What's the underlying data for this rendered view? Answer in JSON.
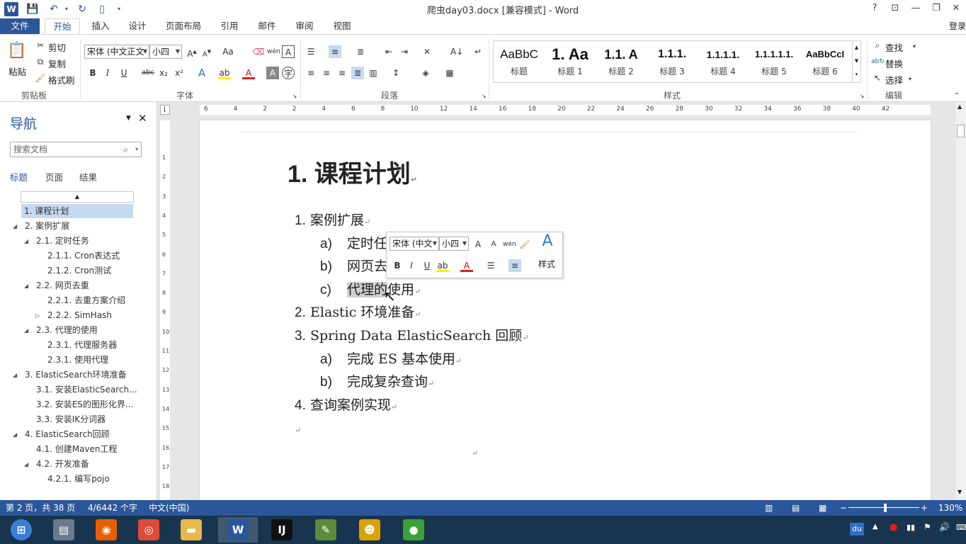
{
  "window": {
    "title": "爬虫day03.docx [兼容模式] - Word",
    "controls": {
      "help": "?",
      "restore_ribbon": "⊡",
      "minimize": "—",
      "maximize": "❐",
      "close": "✕"
    }
  },
  "ribbon_tabs": [
    "文件",
    "开始",
    "插入",
    "设计",
    "页面布局",
    "引用",
    "邮件",
    "审阅",
    "视图"
  ],
  "login_label": "登录",
  "ribbon": {
    "clipboard": {
      "paste": "粘贴",
      "cut": "剪切",
      "copy": "复制",
      "format_painter": "格式刷",
      "label": "剪贴板"
    },
    "font": {
      "name": "宋体 (中文正文",
      "size": "小四",
      "label": "字体"
    },
    "paragraph": {
      "label": "段落"
    },
    "styles": {
      "label": "样式",
      "items": [
        {
          "sample": "AaBbC",
          "name": "标题"
        },
        {
          "sample": "1. ",
          "name": "标题 1"
        },
        {
          "sample": "1.1. A",
          "name": "标题 2"
        },
        {
          "sample": "1.1.1.",
          "name": "标题 3"
        },
        {
          "sample": "1.1.1.1.",
          "name": "标题 4"
        },
        {
          "sample": "1.1.1.1.1.",
          "name": "标题 5"
        },
        {
          "sample": "AaBbCcI",
          "name": "标题 6"
        }
      ]
    },
    "editing": {
      "find": "查找",
      "replace": "替换",
      "select": "选择",
      "label": "编辑"
    }
  },
  "nav": {
    "title": "导航",
    "search_placeholder": "搜索文档",
    "tabs": [
      "标题",
      "页面",
      "结果"
    ],
    "items": [
      {
        "text": "1. 课程计划",
        "level": 1,
        "toggle": "",
        "selected": true
      },
      {
        "text": "2. 案例扩展",
        "level": 1,
        "toggle": "◢"
      },
      {
        "text": "2.1. 定时任务",
        "level": 2,
        "toggle": "◢"
      },
      {
        "text": "2.1.1. Cron表达式",
        "level": 3,
        "toggle": ""
      },
      {
        "text": "2.1.2. Cron测试",
        "level": 3,
        "toggle": ""
      },
      {
        "text": "2.2. 网页去重",
        "level": 2,
        "toggle": "◢"
      },
      {
        "text": "2.2.1. 去重方案介绍",
        "level": 3,
        "toggle": ""
      },
      {
        "text": "2.2.2. SimHash",
        "level": 3,
        "toggle": "▷"
      },
      {
        "text": "2.3. 代理的使用",
        "level": 2,
        "toggle": "◢"
      },
      {
        "text": "2.3.1. 代理服务器",
        "level": 3,
        "toggle": ""
      },
      {
        "text": "2.3.1. 使用代理",
        "level": 3,
        "toggle": ""
      },
      {
        "text": "3. ElasticSearch环境准备",
        "level": 1,
        "toggle": "◢"
      },
      {
        "text": "3.1. 安装ElasticSearch...",
        "level": 2,
        "toggle": ""
      },
      {
        "text": "3.2. 安装ES的图形化界...",
        "level": 2,
        "toggle": ""
      },
      {
        "text": "3.3. 安装IK分词器",
        "level": 2,
        "toggle": ""
      },
      {
        "text": "4. ElasticSearch回顾",
        "level": 1,
        "toggle": "◢"
      },
      {
        "text": "4.1. 创建Maven工程",
        "level": 2,
        "toggle": ""
      },
      {
        "text": "4.2. 开发准备",
        "level": 2,
        "toggle": "◢"
      },
      {
        "text": "4.2.1. 编写pojo",
        "level": 3,
        "toggle": ""
      }
    ]
  },
  "ruler": {
    "h_ticks": [
      "6",
      "4",
      "2",
      "2",
      "4",
      "6",
      "8",
      "10",
      "12",
      "14",
      "16",
      "18",
      "20",
      "22",
      "24",
      "26",
      "28",
      "30",
      "32",
      "34",
      "36",
      "38",
      "40",
      "42"
    ],
    "v_ticks": [
      "1",
      "2",
      "3",
      "4",
      "5",
      "6",
      "7",
      "8",
      "9",
      "10",
      "11",
      "12",
      "13",
      "14",
      "15",
      "16",
      "17",
      "18"
    ]
  },
  "document": {
    "heading": "1. 课程计划",
    "lines": [
      {
        "num": "1.",
        "text": "案例扩展"
      },
      {
        "num": "a)",
        "text": "定时任"
      },
      {
        "num": "b)",
        "text": "网页去"
      },
      {
        "num": "c)",
        "text": "代理的使用",
        "selected_part": "代理的"
      },
      {
        "num": "2.",
        "text": "Elastic 环境准备"
      },
      {
        "num": "3.",
        "text": "Spring Data ElasticSearch 回顾"
      },
      {
        "num": "a)",
        "text": "完成 ES 基本使用"
      },
      {
        "num": "b)",
        "text": "完成复杂查询"
      },
      {
        "num": "4.",
        "text": "查询案例实现"
      }
    ],
    "para_mark": "↵"
  },
  "mini_toolbar": {
    "font": "宋体 (中文",
    "size": "小四",
    "styles_label": "样式"
  },
  "status": {
    "page": "第 2 页，共 38 页",
    "words": "4/6442 个字",
    "language": "中文(中国)",
    "zoom": "130%"
  },
  "taskbar": {
    "apps": [
      {
        "name": "start",
        "glyph": "⊞",
        "color": "#3a7fd5"
      },
      {
        "name": "control-panel",
        "glyph": "▤",
        "color": "#6b7a8b"
      },
      {
        "name": "firefox",
        "glyph": "◉",
        "color": "#e66000"
      },
      {
        "name": "chrome",
        "glyph": "◎",
        "color": "#dd4b39"
      },
      {
        "name": "explorer",
        "glyph": "▬",
        "color": "#e8b84a"
      },
      {
        "name": "word",
        "glyph": "W",
        "color": "#2b579a"
      },
      {
        "name": "intellij",
        "glyph": "IJ",
        "color": "#111111"
      },
      {
        "name": "notepad",
        "glyph": "✎",
        "color": "#5b8c3a"
      },
      {
        "name": "users",
        "glyph": "☻",
        "color": "#d9a400"
      },
      {
        "name": "ball-app",
        "glyph": "●",
        "color": "#3aa23a"
      }
    ],
    "tray": {
      "ime": "du"
    }
  }
}
